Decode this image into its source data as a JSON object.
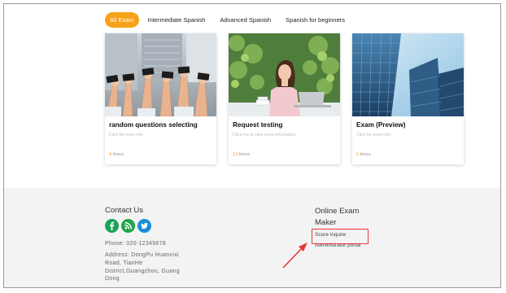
{
  "tabs": [
    {
      "label": "All Exam",
      "active": true
    },
    {
      "label": "Intermediate Spanish",
      "active": false
    },
    {
      "label": "Advanced Spanish",
      "active": false
    },
    {
      "label": "Spanish for beginners",
      "active": false
    }
  ],
  "cards": [
    {
      "title": "random questions selecting",
      "subtitle": "Click for more info",
      "count": "4",
      "count_suffix": "times",
      "image": "hands-holding-cards-photo"
    },
    {
      "title": "Request testing",
      "subtitle": "Click me to view more information.",
      "count": "13",
      "count_suffix": "times",
      "image": "woman-at-laptop-photo"
    },
    {
      "title": "Exam (Preview)",
      "subtitle": "Click for more info",
      "count": "5",
      "count_suffix": "times",
      "image": "glass-skyscrapers-photo"
    }
  ],
  "footer": {
    "contact_title": "Contact Us",
    "social_icons": [
      "facebook-icon",
      "rss-icon",
      "twitter-icon"
    ],
    "phone": "Phone: 020-12345678",
    "address": "Address: DongPu Huanxixi Road, TianHe District,Guangzhou, Guang Dong",
    "exam_title": "Online Exam Maker",
    "links": [
      "Score inquire",
      "Administrator portal"
    ]
  },
  "colors": {
    "accent": "#f7a21b",
    "highlight": "#e53935",
    "facebook": "#1aa35a",
    "rss": "#22a34a",
    "twitter": "#1a8fd6"
  }
}
